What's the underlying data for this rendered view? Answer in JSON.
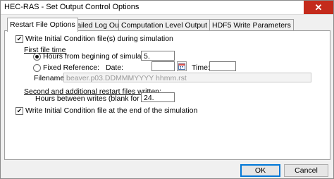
{
  "window": {
    "title": "HEC-RAS - Set Output Control Options",
    "close_glyph": "✕"
  },
  "tabs": [
    {
      "label": "Restart File Options"
    },
    {
      "label": "Detailed Log Output"
    },
    {
      "label": "Computation Level Output Options"
    },
    {
      "label": "HDF5 Write Parameters"
    }
  ],
  "restart": {
    "write_initial": {
      "label": "Write Initial Condition file(s) during simulation",
      "checked": true
    },
    "first_file_time_heading": "First file time",
    "hours_option": {
      "label": "Hours from begining of simulation:",
      "value": "5.",
      "selected": true
    },
    "fixed_option": {
      "label": "Fixed Reference:",
      "selected": false
    },
    "date_label": "Date:",
    "date_value": "",
    "time_label": "Time:",
    "time_value": "",
    "filename_label": "Filename:",
    "filename_value": "beaver.p03.DDMMMYYYY hhmm.rst",
    "second_heading": "Second and additional restart files written:",
    "hours_between_label": "Hours between writes (blank for none):",
    "hours_between_value": "24.",
    "write_end": {
      "label": "Write Initial Condition file at the end of the simulation",
      "checked": true
    }
  },
  "buttons": {
    "ok": "OK",
    "cancel": "Cancel"
  },
  "colors": {
    "close_button": "#c42b1c",
    "default_button_border": "#0078d7",
    "check_mark": "#1a1a1a"
  },
  "icons": {
    "calendar": "calendar-icon",
    "window": "app-icon"
  }
}
